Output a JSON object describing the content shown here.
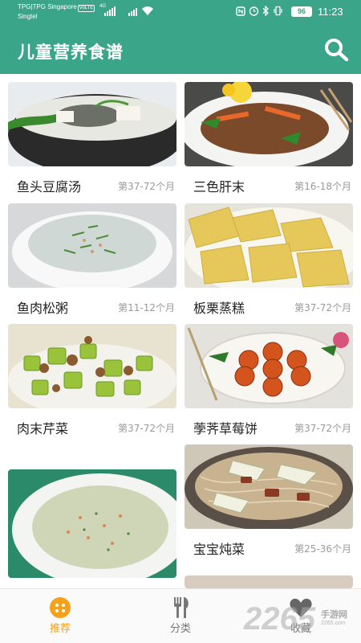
{
  "status_bar": {
    "carrier_line1": "TPG|TPG Singapore",
    "volte": "VoLTE",
    "carrier_line2": "Singtel",
    "network": "4G",
    "battery": "96",
    "time": "11:23"
  },
  "header": {
    "title": "儿童营养食谱",
    "search_icon": "search-icon"
  },
  "recipes": [
    {
      "name": "鱼头豆腐汤",
      "age": "第37-72个月"
    },
    {
      "name": "三色肝末",
      "age": "第16-18个月"
    },
    {
      "name": "鱼肉松粥",
      "age": "第11-12个月"
    },
    {
      "name": "板栗蒸糕",
      "age": "第37-72个月"
    },
    {
      "name": "肉末芹菜",
      "age": "第37-72个月"
    },
    {
      "name": "荸荠草莓饼",
      "age": "第37-72个月"
    },
    {
      "name": "",
      "age": ""
    },
    {
      "name": "宝宝炖菜",
      "age": "第25-36个月"
    }
  ],
  "tabs": [
    {
      "label": "推荐",
      "icon": "recommend-icon",
      "active": true
    },
    {
      "label": "分类",
      "icon": "fork-knife-icon",
      "active": false
    },
    {
      "label": "收藏",
      "icon": "heart-icon",
      "active": false
    }
  ],
  "watermark": {
    "brand": "2265",
    "text": "手游网",
    "url": "2265.com"
  },
  "colors": {
    "primary": "#3aa588",
    "active_tab": "#f5a21a"
  }
}
